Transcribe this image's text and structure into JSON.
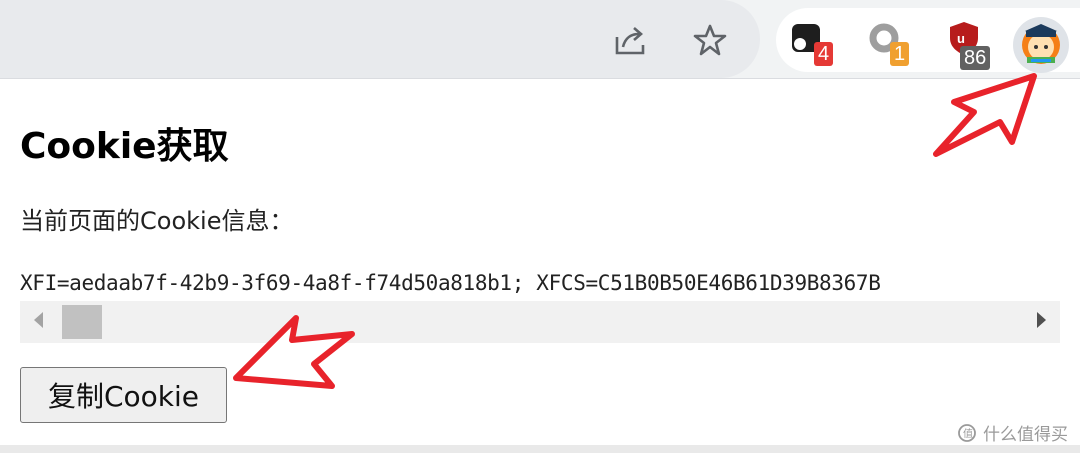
{
  "toolbar": {
    "icons": {
      "share": "share-icon",
      "bookmark": "star-icon"
    },
    "extensions": [
      {
        "name": "ext-dark-square",
        "badge": "4",
        "badge_color": "#e53935"
      },
      {
        "name": "ext-grey-ring",
        "badge": "1",
        "badge_color": "#f0a030"
      },
      {
        "name": "ext-ublock",
        "badge": "86",
        "badge_color": "#616161",
        "icon_color": "#b71c1c"
      }
    ],
    "avatar": "profile-avatar-icon"
  },
  "popup": {
    "title": "Cookie获取",
    "info_label": "当前页面的Cookie信息：",
    "cookie_value": "XFI=aedaab7f-42b9-3f69-4a8f-f74d50a818b1; XFCS=C51B0B50E46B61D39B8367B",
    "copy_button": "复制Cookie"
  },
  "annotations": {
    "arrow_color": "#e8232b"
  },
  "watermark": {
    "text": "什么值得买"
  }
}
